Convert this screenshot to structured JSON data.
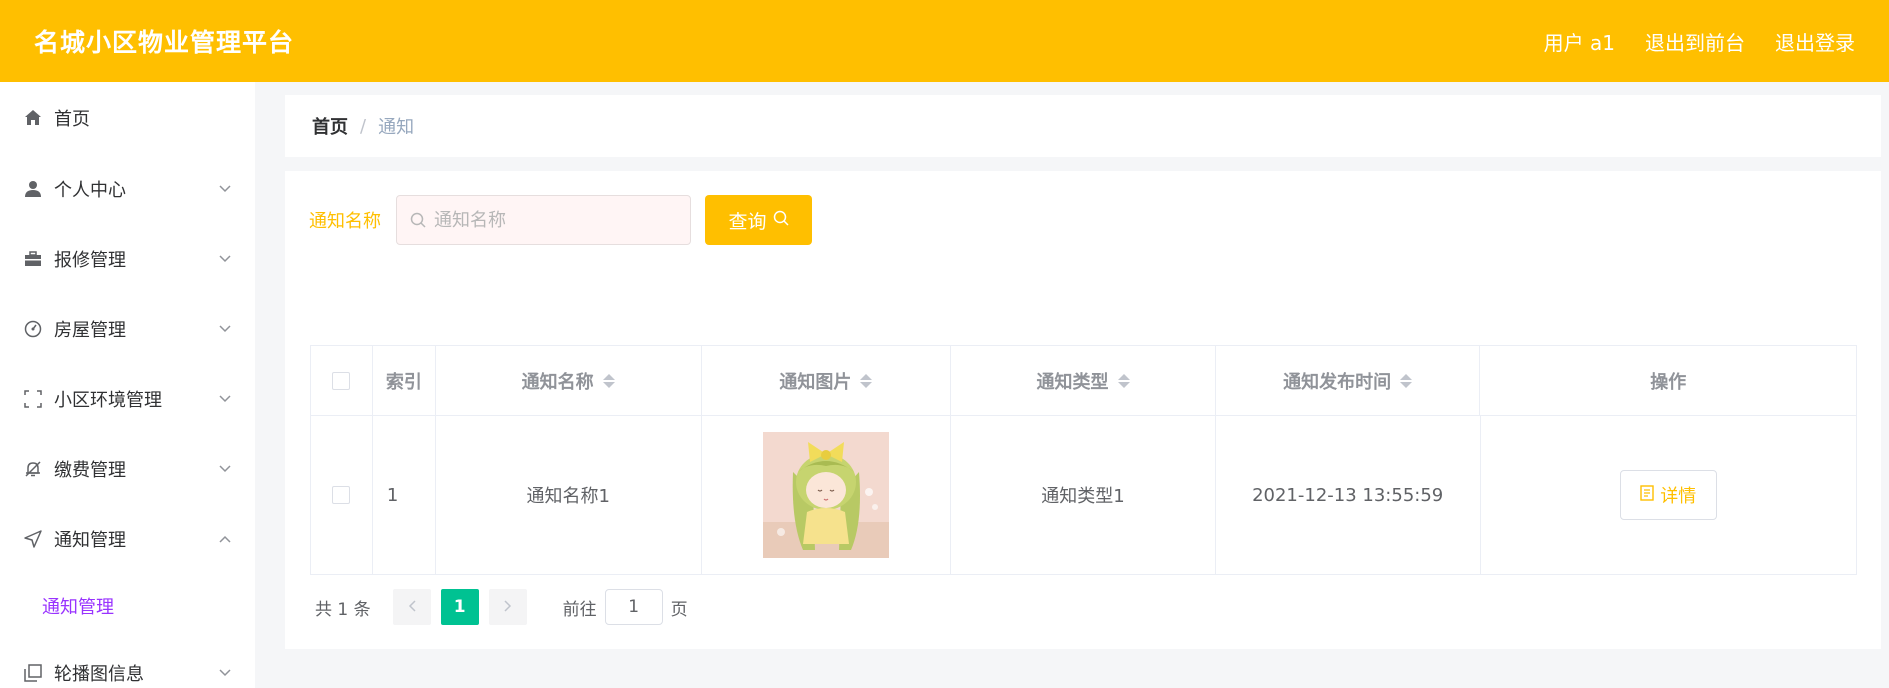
{
  "header": {
    "title": "名城小区物业管理平台",
    "user": "用户 a1",
    "to_front": "退出到前台",
    "logout": "退出登录"
  },
  "sidebar": {
    "items": [
      {
        "label": "首页",
        "icon": "home-icon"
      },
      {
        "label": "个人中心",
        "icon": "user-icon"
      },
      {
        "label": "报修管理",
        "icon": "briefcase-icon"
      },
      {
        "label": "房屋管理",
        "icon": "gauge-icon"
      },
      {
        "label": "小区环境管理",
        "icon": "fullscreen-icon"
      },
      {
        "label": "缴费管理",
        "icon": "bell-off-icon"
      },
      {
        "label": "通知管理",
        "icon": "navigation-icon"
      },
      {
        "label": "轮播图信息",
        "icon": "copy-icon"
      }
    ],
    "subitem": "通知管理"
  },
  "breadcrumb": {
    "home": "首页",
    "separator": "/",
    "current": "通知"
  },
  "search": {
    "label": "通知名称",
    "placeholder": "通知名称",
    "button": "查询"
  },
  "table": {
    "headers": {
      "index": "索引",
      "name": "通知名称",
      "image": "通知图片",
      "type": "通知类型",
      "time": "通知发布时间",
      "op": "操作"
    },
    "rows": [
      {
        "index": "1",
        "name": "通知名称1",
        "type": "通知类型1",
        "time": "2021-12-13 13:55:59",
        "action": "详情"
      }
    ]
  },
  "pagination": {
    "total": "共 1 条",
    "current_page": "1",
    "goto_label": "前往",
    "goto_value": "1",
    "page_suffix": "页"
  },
  "colors": {
    "accent": "#ffbf00",
    "active_page": "#00c292",
    "active_submenu": "#9933ff"
  }
}
